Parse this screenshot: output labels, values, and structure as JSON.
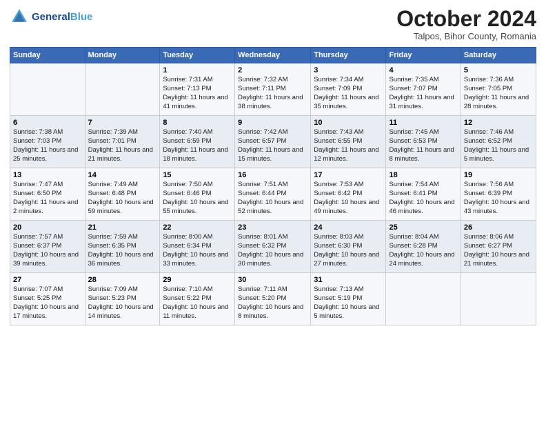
{
  "header": {
    "logo_line1": "General",
    "logo_line2": "Blue",
    "month": "October 2024",
    "location": "Talpos, Bihor County, Romania"
  },
  "weekdays": [
    "Sunday",
    "Monday",
    "Tuesday",
    "Wednesday",
    "Thursday",
    "Friday",
    "Saturday"
  ],
  "rows": [
    [
      {
        "day": "",
        "sunrise": "",
        "sunset": "",
        "daylight": ""
      },
      {
        "day": "",
        "sunrise": "",
        "sunset": "",
        "daylight": ""
      },
      {
        "day": "1",
        "sunrise": "Sunrise: 7:31 AM",
        "sunset": "Sunset: 7:13 PM",
        "daylight": "Daylight: 11 hours and 41 minutes."
      },
      {
        "day": "2",
        "sunrise": "Sunrise: 7:32 AM",
        "sunset": "Sunset: 7:11 PM",
        "daylight": "Daylight: 11 hours and 38 minutes."
      },
      {
        "day": "3",
        "sunrise": "Sunrise: 7:34 AM",
        "sunset": "Sunset: 7:09 PM",
        "daylight": "Daylight: 11 hours and 35 minutes."
      },
      {
        "day": "4",
        "sunrise": "Sunrise: 7:35 AM",
        "sunset": "Sunset: 7:07 PM",
        "daylight": "Daylight: 11 hours and 31 minutes."
      },
      {
        "day": "5",
        "sunrise": "Sunrise: 7:36 AM",
        "sunset": "Sunset: 7:05 PM",
        "daylight": "Daylight: 11 hours and 28 minutes."
      }
    ],
    [
      {
        "day": "6",
        "sunrise": "Sunrise: 7:38 AM",
        "sunset": "Sunset: 7:03 PM",
        "daylight": "Daylight: 11 hours and 25 minutes."
      },
      {
        "day": "7",
        "sunrise": "Sunrise: 7:39 AM",
        "sunset": "Sunset: 7:01 PM",
        "daylight": "Daylight: 11 hours and 21 minutes."
      },
      {
        "day": "8",
        "sunrise": "Sunrise: 7:40 AM",
        "sunset": "Sunset: 6:59 PM",
        "daylight": "Daylight: 11 hours and 18 minutes."
      },
      {
        "day": "9",
        "sunrise": "Sunrise: 7:42 AM",
        "sunset": "Sunset: 6:57 PM",
        "daylight": "Daylight: 11 hours and 15 minutes."
      },
      {
        "day": "10",
        "sunrise": "Sunrise: 7:43 AM",
        "sunset": "Sunset: 6:55 PM",
        "daylight": "Daylight: 11 hours and 12 minutes."
      },
      {
        "day": "11",
        "sunrise": "Sunrise: 7:45 AM",
        "sunset": "Sunset: 6:53 PM",
        "daylight": "Daylight: 11 hours and 8 minutes."
      },
      {
        "day": "12",
        "sunrise": "Sunrise: 7:46 AM",
        "sunset": "Sunset: 6:52 PM",
        "daylight": "Daylight: 11 hours and 5 minutes."
      }
    ],
    [
      {
        "day": "13",
        "sunrise": "Sunrise: 7:47 AM",
        "sunset": "Sunset: 6:50 PM",
        "daylight": "Daylight: 11 hours and 2 minutes."
      },
      {
        "day": "14",
        "sunrise": "Sunrise: 7:49 AM",
        "sunset": "Sunset: 6:48 PM",
        "daylight": "Daylight: 10 hours and 59 minutes."
      },
      {
        "day": "15",
        "sunrise": "Sunrise: 7:50 AM",
        "sunset": "Sunset: 6:46 PM",
        "daylight": "Daylight: 10 hours and 55 minutes."
      },
      {
        "day": "16",
        "sunrise": "Sunrise: 7:51 AM",
        "sunset": "Sunset: 6:44 PM",
        "daylight": "Daylight: 10 hours and 52 minutes."
      },
      {
        "day": "17",
        "sunrise": "Sunrise: 7:53 AM",
        "sunset": "Sunset: 6:42 PM",
        "daylight": "Daylight: 10 hours and 49 minutes."
      },
      {
        "day": "18",
        "sunrise": "Sunrise: 7:54 AM",
        "sunset": "Sunset: 6:41 PM",
        "daylight": "Daylight: 10 hours and 46 minutes."
      },
      {
        "day": "19",
        "sunrise": "Sunrise: 7:56 AM",
        "sunset": "Sunset: 6:39 PM",
        "daylight": "Daylight: 10 hours and 43 minutes."
      }
    ],
    [
      {
        "day": "20",
        "sunrise": "Sunrise: 7:57 AM",
        "sunset": "Sunset: 6:37 PM",
        "daylight": "Daylight: 10 hours and 39 minutes."
      },
      {
        "day": "21",
        "sunrise": "Sunrise: 7:59 AM",
        "sunset": "Sunset: 6:35 PM",
        "daylight": "Daylight: 10 hours and 36 minutes."
      },
      {
        "day": "22",
        "sunrise": "Sunrise: 8:00 AM",
        "sunset": "Sunset: 6:34 PM",
        "daylight": "Daylight: 10 hours and 33 minutes."
      },
      {
        "day": "23",
        "sunrise": "Sunrise: 8:01 AM",
        "sunset": "Sunset: 6:32 PM",
        "daylight": "Daylight: 10 hours and 30 minutes."
      },
      {
        "day": "24",
        "sunrise": "Sunrise: 8:03 AM",
        "sunset": "Sunset: 6:30 PM",
        "daylight": "Daylight: 10 hours and 27 minutes."
      },
      {
        "day": "25",
        "sunrise": "Sunrise: 8:04 AM",
        "sunset": "Sunset: 6:28 PM",
        "daylight": "Daylight: 10 hours and 24 minutes."
      },
      {
        "day": "26",
        "sunrise": "Sunrise: 8:06 AM",
        "sunset": "Sunset: 6:27 PM",
        "daylight": "Daylight: 10 hours and 21 minutes."
      }
    ],
    [
      {
        "day": "27",
        "sunrise": "Sunrise: 7:07 AM",
        "sunset": "Sunset: 5:25 PM",
        "daylight": "Daylight: 10 hours and 17 minutes."
      },
      {
        "day": "28",
        "sunrise": "Sunrise: 7:09 AM",
        "sunset": "Sunset: 5:23 PM",
        "daylight": "Daylight: 10 hours and 14 minutes."
      },
      {
        "day": "29",
        "sunrise": "Sunrise: 7:10 AM",
        "sunset": "Sunset: 5:22 PM",
        "daylight": "Daylight: 10 hours and 11 minutes."
      },
      {
        "day": "30",
        "sunrise": "Sunrise: 7:11 AM",
        "sunset": "Sunset: 5:20 PM",
        "daylight": "Daylight: 10 hours and 8 minutes."
      },
      {
        "day": "31",
        "sunrise": "Sunrise: 7:13 AM",
        "sunset": "Sunset: 5:19 PM",
        "daylight": "Daylight: 10 hours and 5 minutes."
      },
      {
        "day": "",
        "sunrise": "",
        "sunset": "",
        "daylight": ""
      },
      {
        "day": "",
        "sunrise": "",
        "sunset": "",
        "daylight": ""
      }
    ]
  ]
}
